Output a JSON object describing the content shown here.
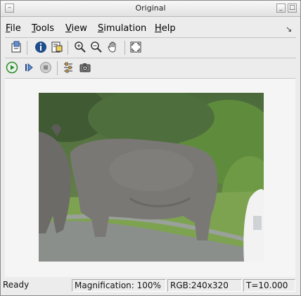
{
  "window": {
    "title": "Original"
  },
  "menu": [
    {
      "label": "File",
      "u": "F",
      "rest": "ile"
    },
    {
      "label": "Tools",
      "u": "T",
      "rest": "ools"
    },
    {
      "label": "View",
      "u": "V",
      "rest": "iew"
    },
    {
      "label": "Simulation",
      "u": "S",
      "rest": "imulation"
    },
    {
      "label": "Help",
      "u": "H",
      "rest": "elp"
    }
  ],
  "toolbar1": [
    "new-window-icon",
    "info-icon",
    "export-icon",
    "zoom-in-icon",
    "zoom-out-icon",
    "pan-hand-icon",
    "fit-to-window-icon"
  ],
  "toolbar2": [
    "play-icon",
    "step-forward-icon",
    "stop-icon",
    "settings-icon",
    "snapshot-camera-icon"
  ],
  "status": {
    "state": "Ready",
    "magnification": "Magnification: 100%",
    "rgb": "RGB:240x320",
    "time": "T=10.000"
  },
  "colors": {
    "accent_green": "#2f8a2f",
    "info_blue": "#1f4c8a"
  }
}
